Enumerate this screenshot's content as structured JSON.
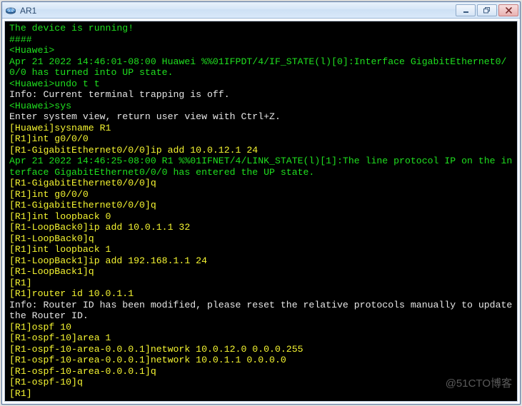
{
  "window": {
    "title": "AR1",
    "icon": "router-icon"
  },
  "controls": {
    "min_glyph": "__",
    "restore_glyph": "❐",
    "close_glyph": "✕"
  },
  "colors": {
    "system": "#1fe01f",
    "info": "#e6e6e6",
    "config": "#f5f531",
    "bg": "#000000"
  },
  "terminal": {
    "lines": [
      {
        "cls": "sys",
        "text": "The device is running!"
      },
      {
        "cls": "sys",
        "text": "####"
      },
      {
        "cls": "sys",
        "text": "<Huawei>"
      },
      {
        "cls": "sys",
        "text": "Apr 21 2022 14:46:01-08:00 Huawei %%01IFPDT/4/IF_STATE(l)[0]:Interface GigabitEthernet0/0/0 has turned into UP state."
      },
      {
        "cls": "sys",
        "text": "<Huawei>undo t t"
      },
      {
        "cls": "info",
        "text": "Info: Current terminal trapping is off."
      },
      {
        "cls": "sys",
        "text": "<Huawei>sys"
      },
      {
        "cls": "info",
        "text": "Enter system view, return user view with Ctrl+Z."
      },
      {
        "cls": "cfg",
        "text": "[Huawei]sysname R1"
      },
      {
        "cls": "cfg",
        "text": "[R1]int g0/0/0"
      },
      {
        "cls": "cfg",
        "text": "[R1-GigabitEthernet0/0/0]ip add 10.0.12.1 24"
      },
      {
        "cls": "sys",
        "text": "Apr 21 2022 14:46:25-08:00 R1 %%01IFNET/4/LINK_STATE(l)[1]:The line protocol IP on the interface GigabitEthernet0/0/0 has entered the UP state."
      },
      {
        "cls": "cfg",
        "text": "[R1-GigabitEthernet0/0/0]q"
      },
      {
        "cls": "cfg",
        "text": "[R1]int g0/0/0"
      },
      {
        "cls": "cfg",
        "text": "[R1-GigabitEthernet0/0/0]q"
      },
      {
        "cls": "cfg",
        "text": "[R1]int loopback 0"
      },
      {
        "cls": "cfg",
        "text": "[R1-LoopBack0]ip add 10.0.1.1 32"
      },
      {
        "cls": "cfg",
        "text": "[R1-LoopBack0]q"
      },
      {
        "cls": "cfg",
        "text": "[R1]int loopback 1"
      },
      {
        "cls": "cfg",
        "text": "[R1-LoopBack1]ip add 192.168.1.1 24"
      },
      {
        "cls": "cfg",
        "text": "[R1-LoopBack1]q"
      },
      {
        "cls": "cfg",
        "text": "[R1]"
      },
      {
        "cls": "cfg",
        "text": "[R1]router id 10.0.1.1"
      },
      {
        "cls": "info",
        "text": "Info: Router ID has been modified, please reset the relative protocols manually to update the Router ID."
      },
      {
        "cls": "cfg",
        "text": "[R1]ospf 10"
      },
      {
        "cls": "cfg",
        "text": "[R1-ospf-10]area 1"
      },
      {
        "cls": "cfg",
        "text": "[R1-ospf-10-area-0.0.0.1]network 10.0.12.0 0.0.0.255"
      },
      {
        "cls": "cfg",
        "text": "[R1-ospf-10-area-0.0.0.1]network 10.0.1.1 0.0.0.0"
      },
      {
        "cls": "cfg",
        "text": "[R1-ospf-10-area-0.0.0.1]q"
      },
      {
        "cls": "cfg",
        "text": "[R1-ospf-10]q"
      },
      {
        "cls": "cfg",
        "text": "[R1]"
      }
    ]
  },
  "watermark": "@51CTO博客"
}
